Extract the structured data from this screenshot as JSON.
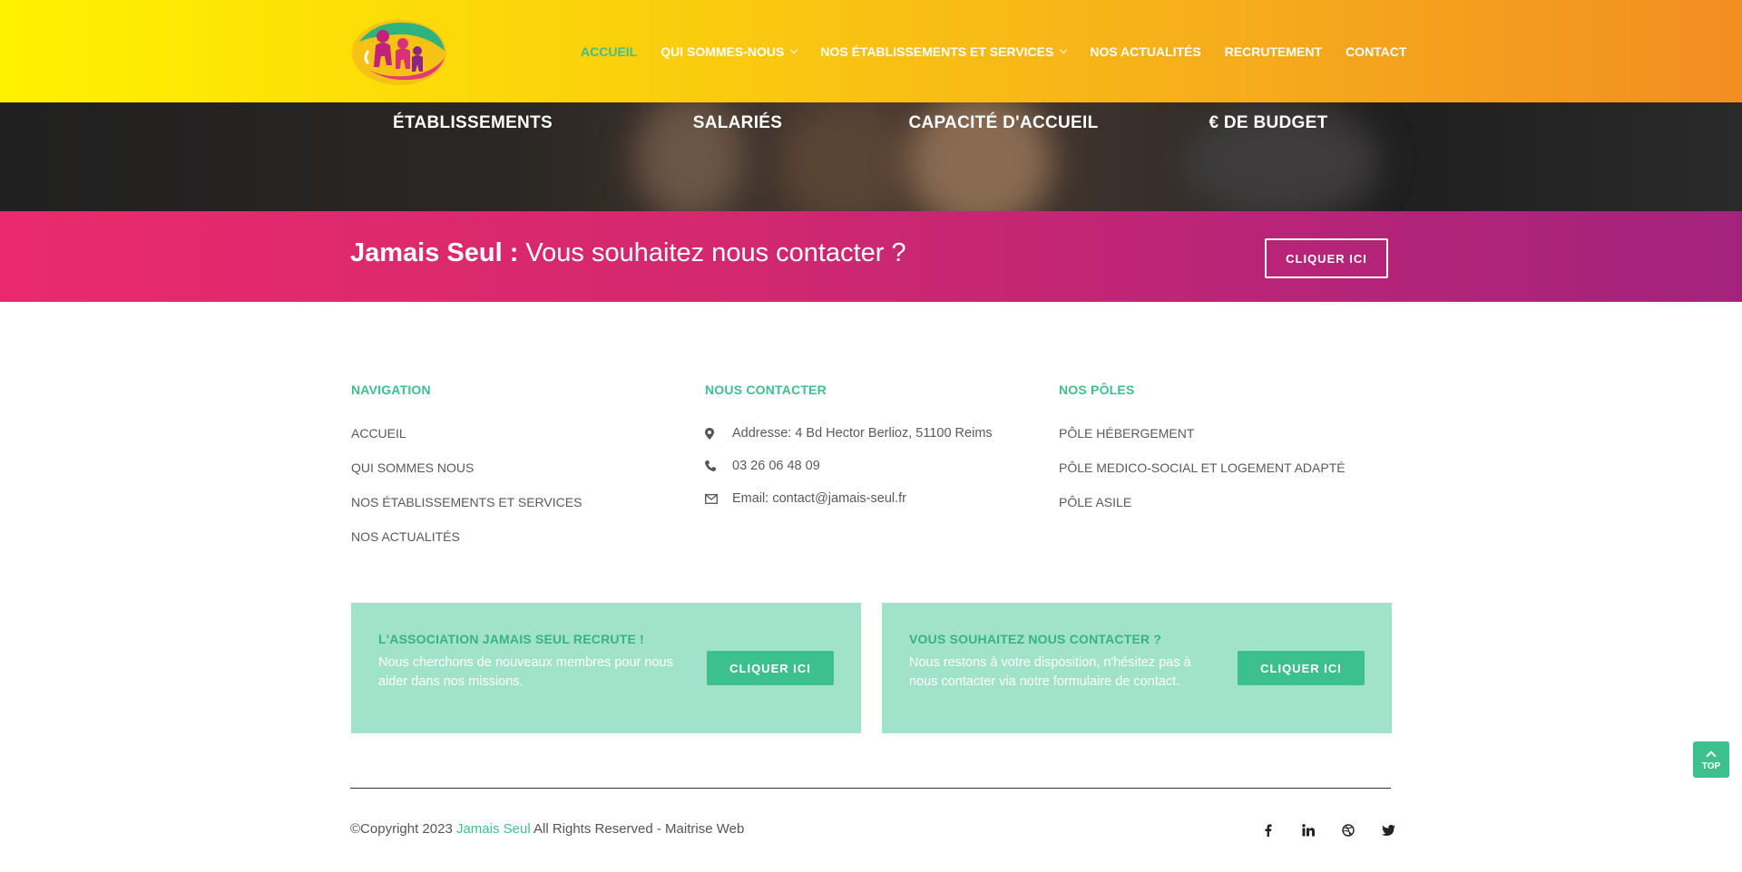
{
  "header": {
    "nav": [
      {
        "label": "ACCUEIL",
        "active": true,
        "dropdown": false
      },
      {
        "label": "QUI SOMMES-NOUS",
        "active": false,
        "dropdown": true
      },
      {
        "label": "NOS ÉTABLISSEMENTS ET SERVICES",
        "active": false,
        "dropdown": true
      },
      {
        "label": "NOS ACTUALITÉS",
        "active": false,
        "dropdown": false
      },
      {
        "label": "RECRUTEMENT",
        "active": false,
        "dropdown": false
      },
      {
        "label": "CONTACT",
        "active": false,
        "dropdown": false
      }
    ]
  },
  "stats": {
    "labels": [
      "ÉTABLISSEMENTS",
      "SALARIÉS",
      "CAPACITÉ D'ACCUEIL",
      "€ DE BUDGET"
    ]
  },
  "cta": {
    "title_bold": "Jamais Seul :",
    "title_rest": " Vous souhaitez nous contacter ?",
    "button": "CLIQUER ICI"
  },
  "footer": {
    "navigation": {
      "title": "NAVIGATION",
      "links": [
        "ACCUEIL",
        "QUI SOMMES NOUS",
        "NOS ÉTABLISSEMENTS ET SERVICES",
        "NOS ACTUALITÉS"
      ]
    },
    "contact": {
      "title": "NOUS CONTACTER",
      "address": "Addresse: 4 Bd Hector Berlioz, 51100 Reims",
      "phone": "03 26 06 48 09",
      "email": "Email: contact@jamais-seul.fr"
    },
    "poles": {
      "title": "NOS PÔLES",
      "links": [
        "PÔLE HÉBERGEMENT",
        "PÔLE MEDICO-SOCIAL ET LOGEMENT ADAPTÉ",
        "PÔLE ASILE"
      ]
    },
    "boxes": [
      {
        "title": "L'ASSOCIATION JAMAIS SEUL RECRUTE !",
        "text": "Nous cherchons de nouveaux membres pour nous aider dans nos missions.",
        "button": "CLIQUER ICI"
      },
      {
        "title": "VOUS SOUHAITEZ NOUS CONTACTER ?",
        "text": "Nous restons à votre disposition, n'hésitez pas à nous contacter via notre formulaire de contact.",
        "button": "CLIQUER ICI"
      }
    ],
    "copyright_prefix": "©Copyright 2023 ",
    "copyright_brand": "Jamais Seul",
    "copyright_suffix": " All Rights Reserved - Maitrise Web",
    "social_icons": [
      "facebook-icon",
      "linkedin-icon",
      "dribbble-icon",
      "twitter-icon"
    ]
  },
  "top_button": {
    "label": "TOP"
  },
  "colors": {
    "accent_green": "#3fbf8f",
    "box_green": "#a1e3ca",
    "cta_pink": "#ea2a6c",
    "header_yellow": "#fff200",
    "header_orange": "#f28e22"
  }
}
